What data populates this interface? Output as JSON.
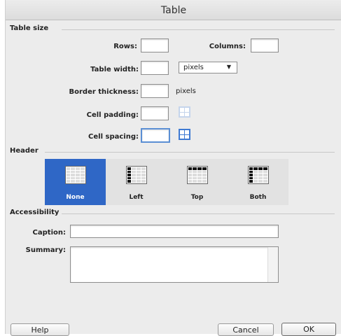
{
  "window": {
    "title": "Table"
  },
  "table_size": {
    "section_label": "Table size",
    "rows_label": "Rows:",
    "rows_value": "",
    "columns_label": "Columns:",
    "columns_value": "",
    "width_label": "Table width:",
    "width_value": "",
    "width_unit_selected": "pixels",
    "border_label": "Border thickness:",
    "border_value": "",
    "border_unit": "pixels",
    "padding_label": "Cell padding:",
    "padding_value": "",
    "spacing_label": "Cell spacing:",
    "spacing_value": ""
  },
  "header": {
    "section_label": "Header",
    "options": [
      {
        "label": "None",
        "selected": true
      },
      {
        "label": "Left",
        "selected": false
      },
      {
        "label": "Top",
        "selected": false
      },
      {
        "label": "Both",
        "selected": false
      }
    ]
  },
  "accessibility": {
    "section_label": "Accessibility",
    "caption_label": "Caption:",
    "caption_value": "",
    "summary_label": "Summary:",
    "summary_value": ""
  },
  "buttons": {
    "help": "Help",
    "cancel": "Cancel",
    "ok": "OK"
  },
  "colors": {
    "accent": "#2f67c6",
    "focus_ring": "#5b8fd4",
    "dialog_bg": "#ececec"
  }
}
